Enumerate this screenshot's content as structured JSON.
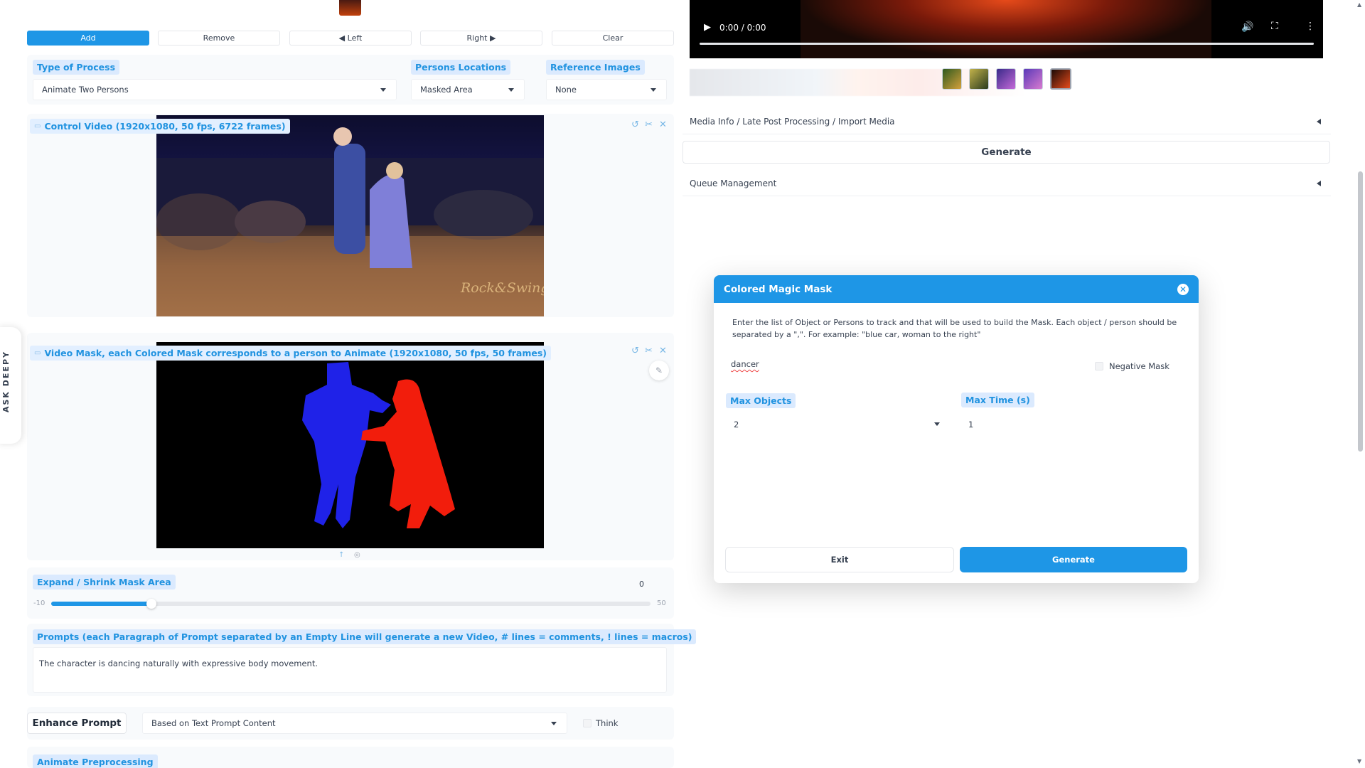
{
  "toolbar": {
    "add": "Add",
    "remove": "Remove",
    "left": "◀ Left",
    "right": "Right ▶",
    "clear": "Clear"
  },
  "process": {
    "type_label": "Type of Process",
    "type_value": "Animate Two Persons",
    "persons_label": "Persons Locations",
    "persons_value": "Masked Area",
    "ref_label": "Reference Images",
    "ref_value": "None"
  },
  "control_video": {
    "label": "Control Video (1920x1080, 50 fps, 6722 frames)",
    "watermark": "Rock&Swing"
  },
  "video_mask": {
    "label": "Video Mask, each Colored Mask corresponds to a person to Animate (1920x1080, 50 fps, 50 frames)"
  },
  "expand": {
    "label": "Expand / Shrink Mask Area",
    "value": "0",
    "min": "-10",
    "max": "50",
    "fraction": 0.1667
  },
  "prompts": {
    "label": "Prompts (each Paragraph of Prompt separated by an Empty Line will generate a new Video, # lines = comments, ! lines = macros)",
    "text": "The character is dancing naturally with expressive body movement."
  },
  "enhance": {
    "button": "Enhance Prompt",
    "mode": "Based on Text Prompt Content",
    "think": "Think"
  },
  "animate_preprocessing": "Animate Preprocessing",
  "ask_deepy": "ASK DEEPY",
  "player": {
    "time": "0:00 / 0:00"
  },
  "right": {
    "media_info": "Media Info / Late Post Processing / Import Media",
    "generate": "Generate",
    "queue": "Queue Management"
  },
  "modal": {
    "title": "Colored Magic Mask",
    "description": "Enter the list of Object or Persons to track and that will be used to build the Mask. Each object / person should be separated by a \",\". For example: \"blue car, woman to the right\"",
    "input_value": "dancer",
    "negative_mask": "Negative Mask",
    "max_objects_label": "Max Objects",
    "max_objects_value": "2",
    "max_time_label": "Max Time (s)",
    "max_time_value": "1",
    "exit": "Exit",
    "generate": "Generate"
  },
  "colors": {
    "accent": "#1e96e6",
    "mask_blue": "#1f22e8",
    "mask_red": "#f21d0c"
  }
}
